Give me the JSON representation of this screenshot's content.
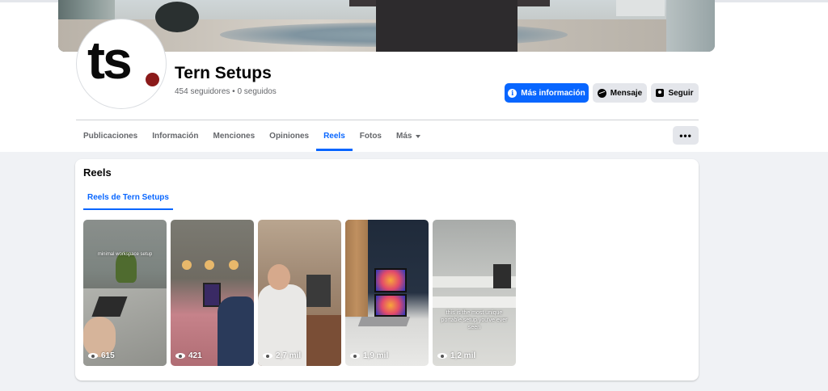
{
  "page": {
    "name": "Tern Setups",
    "followers": "454 seguidores • 0 seguidos",
    "avatar_text": "ts"
  },
  "actions": {
    "info_label": "Más información",
    "message_label": "Mensaje",
    "follow_label": "Seguir",
    "more_label": "•••"
  },
  "tabs": [
    {
      "label": "Publicaciones"
    },
    {
      "label": "Información"
    },
    {
      "label": "Menciones"
    },
    {
      "label": "Opiniones"
    },
    {
      "label": "Reels",
      "active": true
    },
    {
      "label": "Fotos"
    },
    {
      "label": "Más"
    }
  ],
  "reels": {
    "title": "Reels",
    "subtab": "Reels de Tern Setups",
    "items": [
      {
        "views": "615",
        "caption": "minimal workspace setup"
      },
      {
        "views": "421",
        "caption": ""
      },
      {
        "views": "2,7 mil",
        "caption": ""
      },
      {
        "views": "1,9 mil",
        "caption": ""
      },
      {
        "views": "1,2 mil",
        "caption": "this is the most unique portable setup you've ever seen"
      }
    ]
  },
  "colors": {
    "accent": "#0866ff",
    "logo_dot": "#8b1a1a",
    "background": "#f0f2f5"
  },
  "icons": [
    "info-icon",
    "messenger-icon",
    "follow-icon",
    "caret-down-icon",
    "eye-icon"
  ]
}
